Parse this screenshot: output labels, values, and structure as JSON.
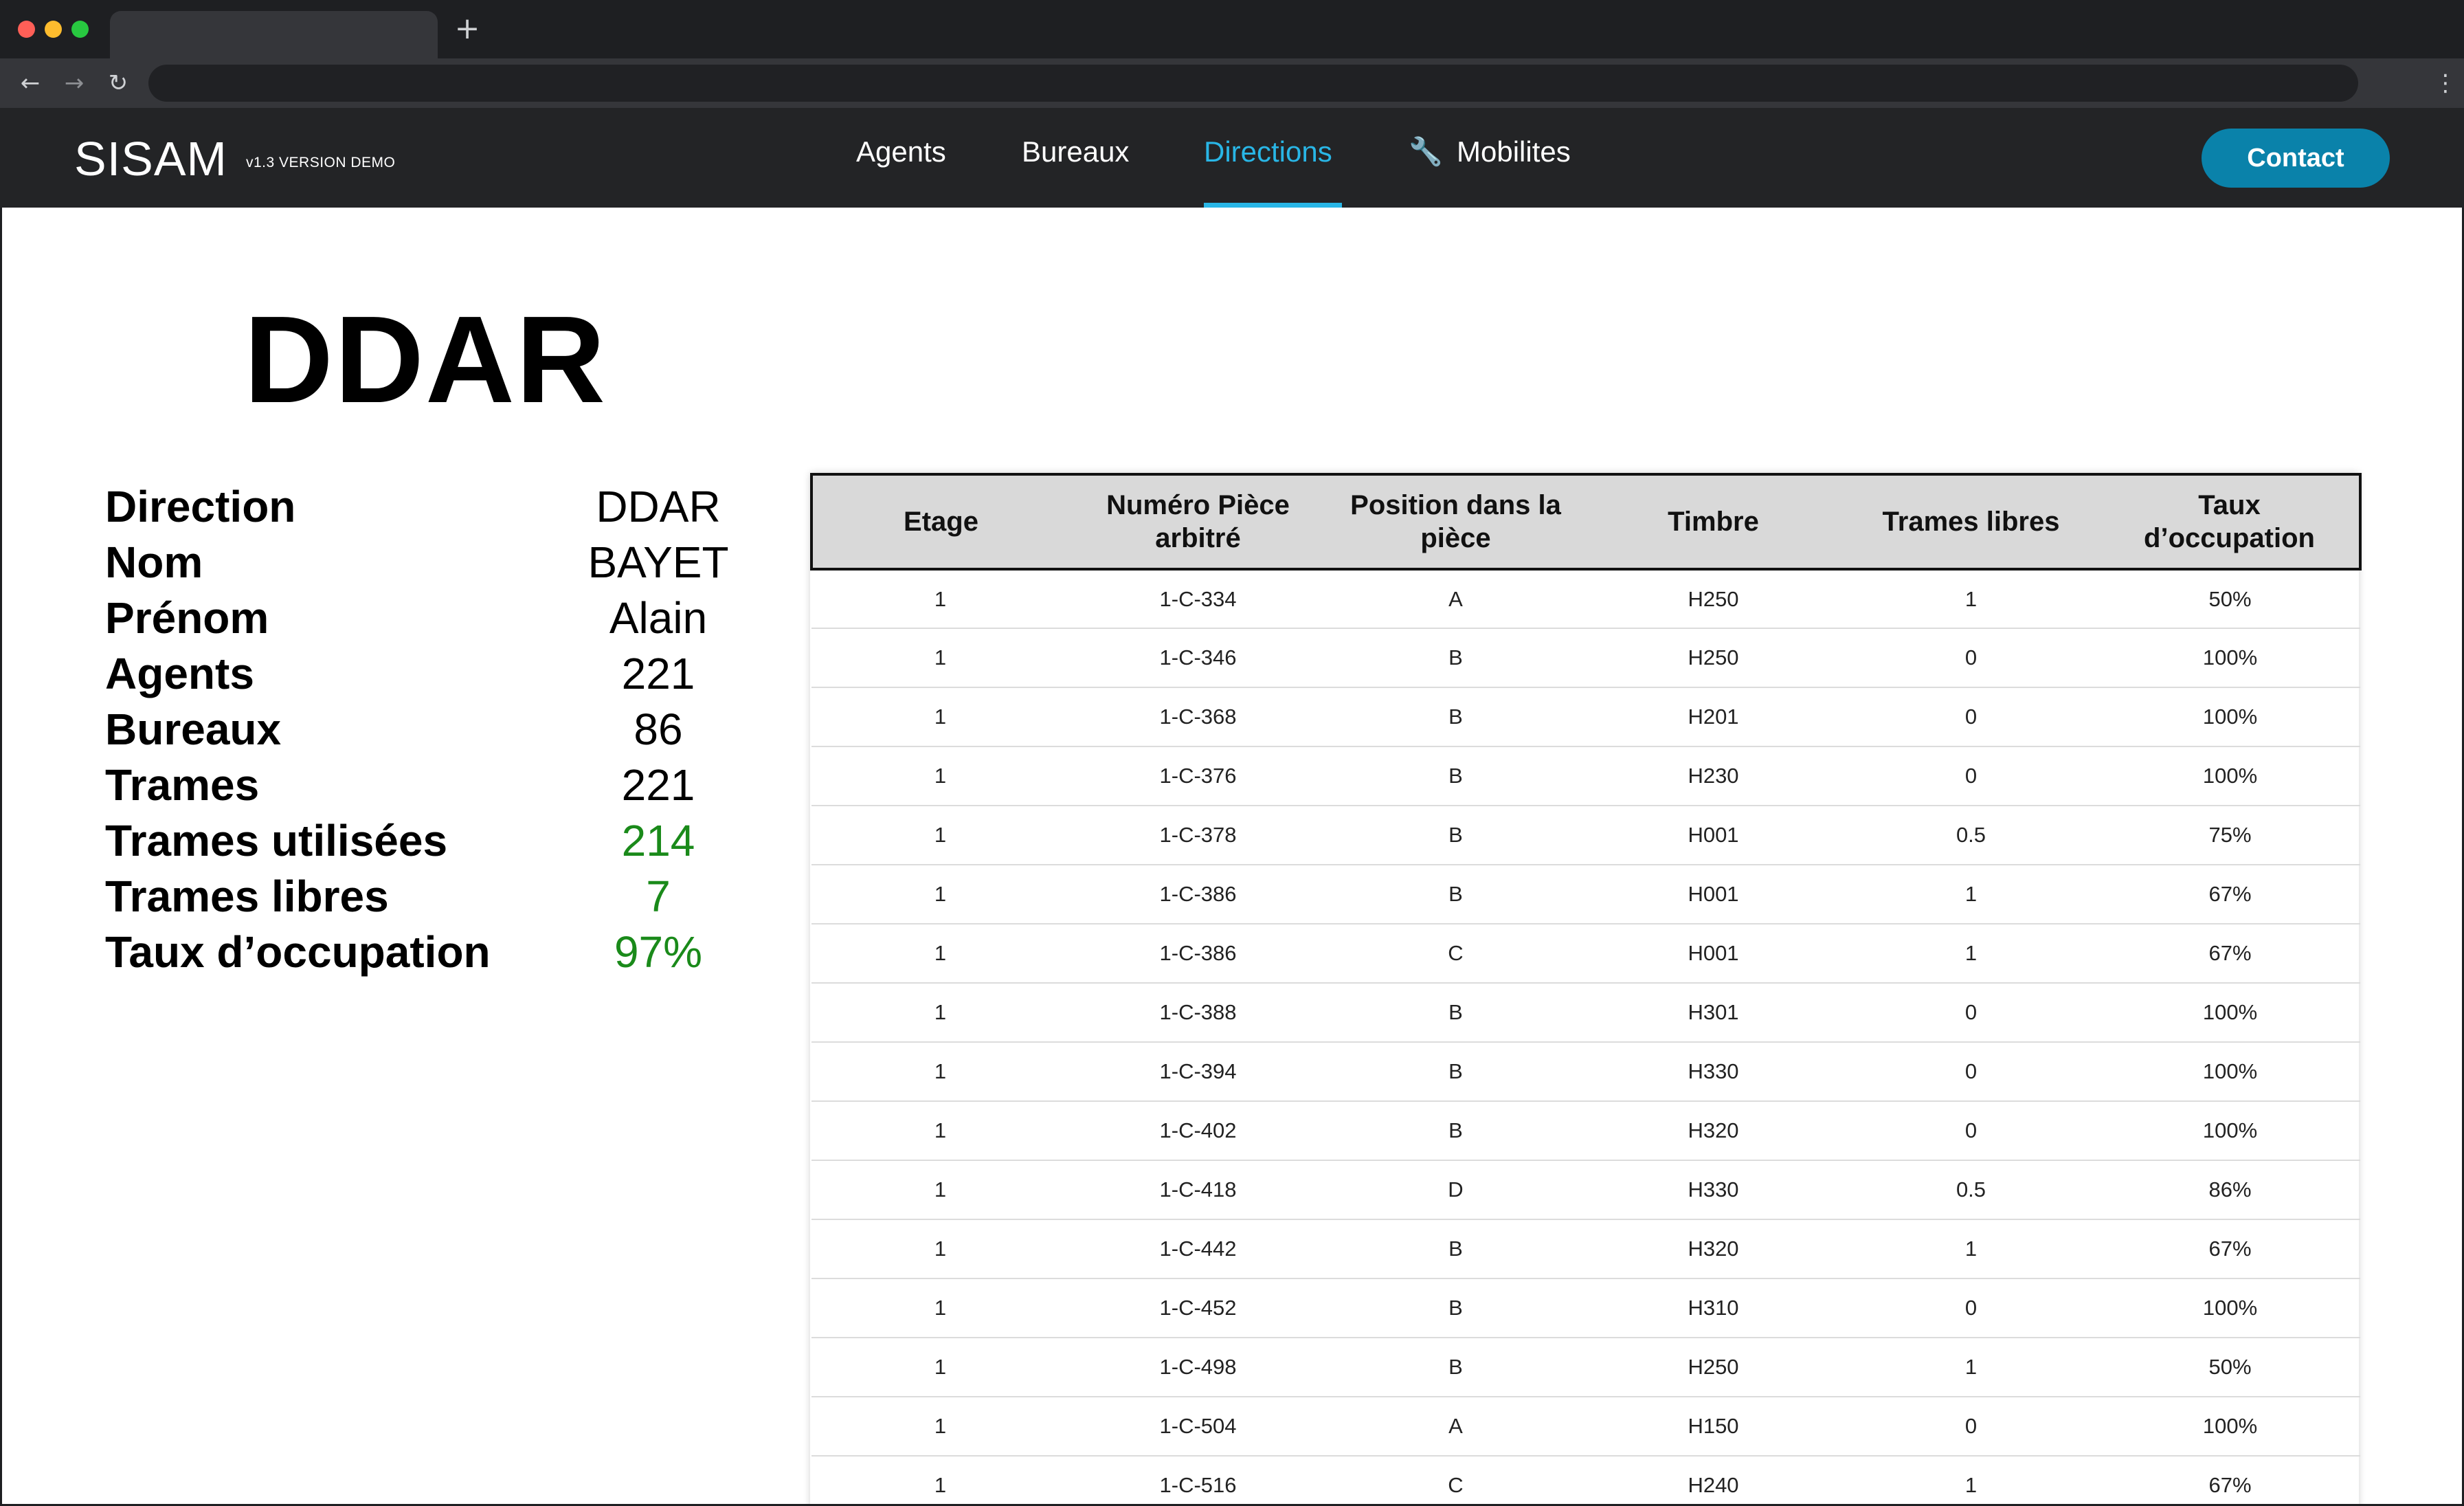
{
  "app": {
    "brand": "SISAM",
    "version": "v1.3 VERSION DEMO",
    "contact_label": "Contact"
  },
  "nav": {
    "agents": "Agents",
    "bureaux": "Bureaux",
    "directions": "Directions",
    "mobilites": "Mobilites",
    "active": "Directions",
    "accent_color": "#29b6e6"
  },
  "icons": {
    "mobilites": "wrench-icon"
  },
  "page": {
    "title": "DDAR"
  },
  "info": [
    {
      "label": "Direction",
      "value": "DDAR"
    },
    {
      "label": "Nom",
      "value": "BAYET"
    },
    {
      "label": "Prénom",
      "value": "Alain"
    },
    {
      "label": "Agents",
      "value": "221"
    },
    {
      "label": "Bureaux",
      "value": "86"
    },
    {
      "label": "Trames",
      "value": "221"
    },
    {
      "label": "Trames utilisées",
      "value": "214"
    },
    {
      "label": "Trames libres",
      "value": "7"
    },
    {
      "label": "Taux d’occupation",
      "value": "97%"
    }
  ],
  "table": {
    "headers": [
      "Etage",
      "Numéro Pièce arbitré",
      "Position dans la pièce",
      "Timbre",
      "Trames libres",
      "Taux d’occupation"
    ],
    "rows": [
      [
        "1",
        "1-C-334",
        "A",
        "H250",
        "1",
        "50%"
      ],
      [
        "1",
        "1-C-346",
        "B",
        "H250",
        "0",
        "100%"
      ],
      [
        "1",
        "1-C-368",
        "B",
        "H201",
        "0",
        "100%"
      ],
      [
        "1",
        "1-C-376",
        "B",
        "H230",
        "0",
        "100%"
      ],
      [
        "1",
        "1-C-378",
        "B",
        "H001",
        "0.5",
        "75%"
      ],
      [
        "1",
        "1-C-386",
        "B",
        "H001",
        "1",
        "67%"
      ],
      [
        "1",
        "1-C-386",
        "C",
        "H001",
        "1",
        "67%"
      ],
      [
        "1",
        "1-C-388",
        "B",
        "H301",
        "0",
        "100%"
      ],
      [
        "1",
        "1-C-394",
        "B",
        "H330",
        "0",
        "100%"
      ],
      [
        "1",
        "1-C-402",
        "B",
        "H320",
        "0",
        "100%"
      ],
      [
        "1",
        "1-C-418",
        "D",
        "H330",
        "0.5",
        "86%"
      ],
      [
        "1",
        "1-C-442",
        "B",
        "H320",
        "1",
        "67%"
      ],
      [
        "1",
        "1-C-452",
        "B",
        "H310",
        "0",
        "100%"
      ],
      [
        "1",
        "1-C-498",
        "B",
        "H250",
        "1",
        "50%"
      ],
      [
        "1",
        "1-C-504",
        "A",
        "H150",
        "0",
        "100%"
      ],
      [
        "1",
        "1-C-516",
        "C",
        "H240",
        "1",
        "67%"
      ]
    ]
  }
}
